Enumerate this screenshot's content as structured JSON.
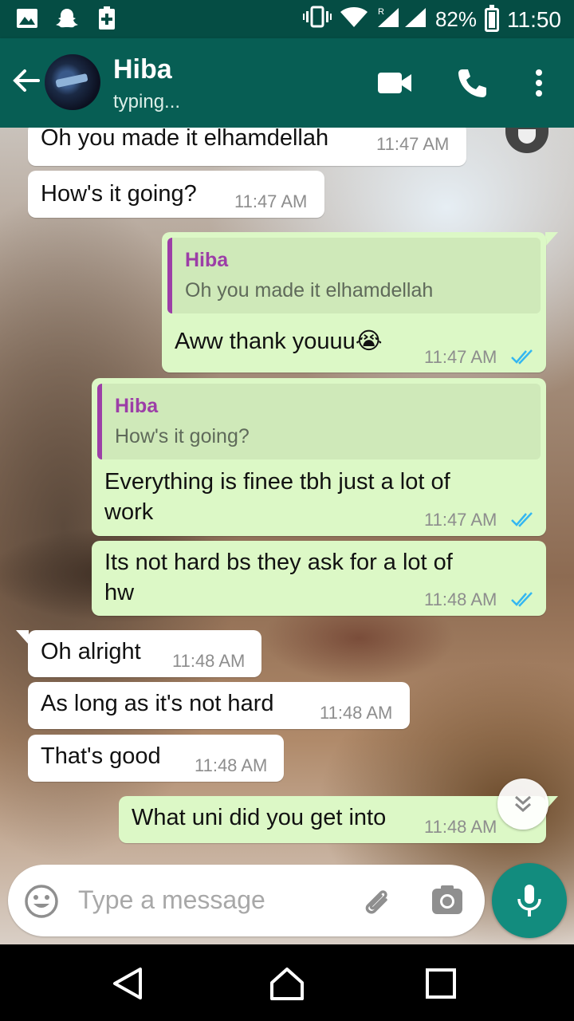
{
  "status_bar": {
    "battery": "82%",
    "time": "11:50"
  },
  "header": {
    "contact_name": "Hiba",
    "status": "typing..."
  },
  "messages": [
    {
      "dir": "in",
      "text": "Oh you made it elhamdellah",
      "time": "11:47 AM"
    },
    {
      "dir": "in",
      "text": "How's it going?",
      "time": "11:47 AM"
    },
    {
      "dir": "out",
      "quote_author": "Hiba",
      "quote_text": "Oh you made it elhamdellah",
      "text": "Aww thank youuu",
      "emoji": "😭",
      "time": "11:47 AM"
    },
    {
      "dir": "out",
      "quote_author": "Hiba",
      "quote_text": "How's it going?",
      "text_line1": "Everything is finee tbh just a lot of",
      "text_line2": "work",
      "time": "11:47 AM"
    },
    {
      "dir": "out",
      "text_line1": "Its not hard bs they ask for a lot of",
      "text_line2": "hw",
      "time": "11:48 AM"
    },
    {
      "dir": "in",
      "text": "Oh alright",
      "time": "11:48 AM"
    },
    {
      "dir": "in",
      "text": "As long as it's not hard",
      "time": "11:48 AM"
    },
    {
      "dir": "in",
      "text": "That's good",
      "time": "11:48 AM"
    },
    {
      "dir": "out",
      "text": "What uni did you get into",
      "time": "11:48 AM"
    }
  ],
  "input": {
    "placeholder": "Type a message"
  },
  "colors": {
    "header": "#075e54",
    "status_bar": "#054d44",
    "outgoing": "#dcf8c6",
    "incoming": "#ffffff",
    "read_ticks": "#34b7f1",
    "mic": "#128c7e",
    "quote_accent": "#9c3ea7"
  },
  "icons": [
    "gallery-icon",
    "snapchat-icon",
    "plus-icon",
    "vibrate-icon",
    "wifi-icon",
    "signal-icon",
    "back-arrow-icon",
    "video-call-icon",
    "phone-icon",
    "more-icon",
    "emoji-icon",
    "attach-icon",
    "camera-icon",
    "mic-icon",
    "double-check-icon",
    "chevron-double-down-icon",
    "nav-back-icon",
    "nav-home-icon",
    "nav-recents-icon"
  ]
}
